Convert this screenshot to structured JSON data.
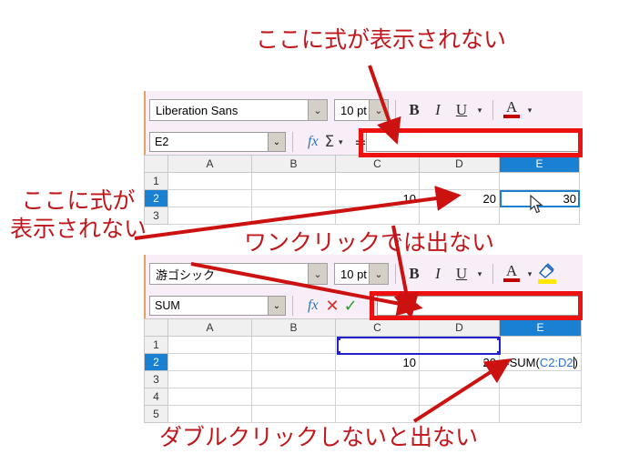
{
  "annotations": {
    "top": "ここに式が表示されない",
    "left_line1": "ここに式が",
    "left_line2": "表示されない",
    "middle": "ワンクリックでは出ない",
    "bottom": "ダブルクリックしないと出ない",
    "color": "#c0171c"
  },
  "accent_colors": {
    "highlight_red": "#ee1111",
    "selection_blue": "#1a80d2",
    "reference_blue": "#2b6fd4",
    "toolbar_background": "#f8eef8",
    "accept_green": "#2aa22a",
    "cancel_red": "#d42c2c"
  },
  "panel_top": {
    "toolbar": {
      "font_name": "Liberation Sans",
      "font_size": "10 pt",
      "bold_label": "B",
      "italic_label": "I",
      "underline_label": "U",
      "font_color_label": "A",
      "dropdown_glyph": "⌄",
      "caret_glyph": "▾"
    },
    "formula_bar": {
      "name_box": "E2",
      "fx_label": "fx",
      "sigma_label": "Σ",
      "equals_label": "=",
      "input_value": "",
      "input_placeholder": ""
    },
    "sheet": {
      "columns": [
        "A",
        "B",
        "C",
        "D",
        "E"
      ],
      "selected_column": "E",
      "rows": [
        {
          "header": "1",
          "selected": false,
          "cells": [
            "",
            "",
            "",
            "",
            ""
          ]
        },
        {
          "header": "2",
          "selected": true,
          "cells": [
            "",
            "",
            "10",
            "20",
            "30"
          ]
        },
        {
          "header": "3",
          "selected": false,
          "cells": [
            "",
            "",
            "",
            "",
            ""
          ]
        }
      ],
      "active_cell": "E2",
      "active_cell_display": "30"
    }
  },
  "panel_bottom": {
    "toolbar": {
      "font_name": "游ゴシック",
      "font_size": "10 pt",
      "bold_label": "B",
      "italic_label": "I",
      "underline_label": "U",
      "font_color_label": "A",
      "dropdown_glyph": "⌄",
      "caret_glyph": "▾",
      "highlight_icon": "highlighting-color-icon"
    },
    "formula_bar": {
      "name_box": "SUM",
      "fx_label": "fx",
      "cancel_label": "✕",
      "accept_label": "✓",
      "input_value": "",
      "input_placeholder": ""
    },
    "sheet": {
      "columns": [
        "A",
        "B",
        "C",
        "D",
        "E"
      ],
      "selected_column": "E",
      "rows": [
        {
          "header": "1",
          "selected": false,
          "cells": [
            "",
            "",
            "",
            "",
            ""
          ]
        },
        {
          "header": "2",
          "selected": true,
          "cells": [
            "",
            "",
            "10",
            "20",
            ""
          ]
        },
        {
          "header": "3",
          "selected": false,
          "cells": [
            "",
            "",
            "",
            "",
            ""
          ]
        },
        {
          "header": "4",
          "selected": false,
          "cells": [
            "",
            "",
            "",
            "",
            ""
          ]
        },
        {
          "header": "5",
          "selected": false,
          "cells": [
            "",
            "",
            "",
            "",
            ""
          ]
        }
      ],
      "editing_cell": "E2",
      "editing_formula_prefix": "=SUM(",
      "editing_formula_reference": "C2:D2",
      "editing_formula_suffix": ")",
      "highlighted_range": "C2:D2"
    }
  }
}
